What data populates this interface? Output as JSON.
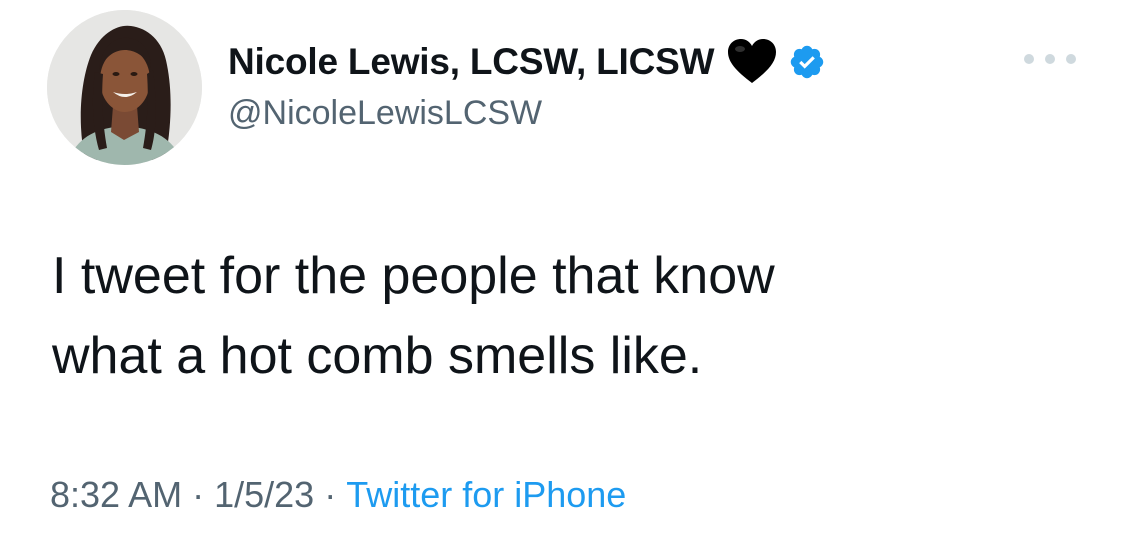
{
  "author": {
    "display_name": "Nicole Lewis, LCSW, LICSW",
    "handle": "@NicoleLewisLCSW",
    "emoji": "black-heart",
    "verified": true
  },
  "tweet": {
    "lines": [
      "I tweet for the people that know",
      "what a hot comb smells like."
    ]
  },
  "meta": {
    "time": "8:32 AM",
    "separator": "·",
    "date": "1/5/23",
    "source": "Twitter for iPhone"
  },
  "icons": {
    "heart": "black-heart-icon",
    "verified": "verified-badge-icon",
    "more": "more-options-icon"
  },
  "colors": {
    "text": "#0f1419",
    "secondary": "#536471",
    "link": "#1d9bf0",
    "verified": "#1d9bf0"
  }
}
